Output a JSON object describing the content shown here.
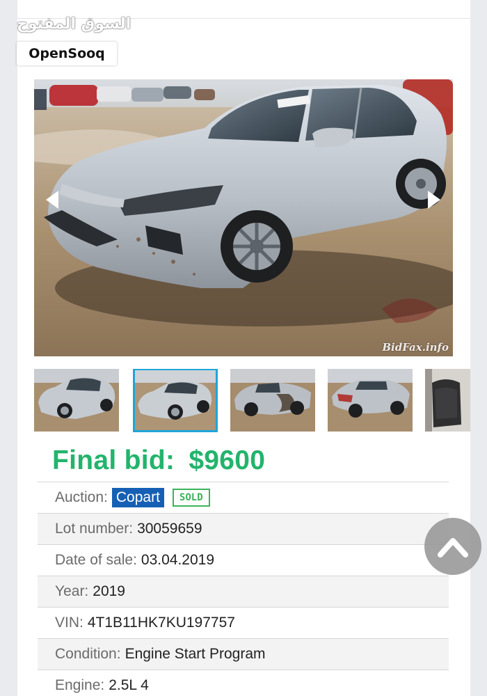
{
  "watermark": {
    "arabic": "السوق المفتوح",
    "brand": "OpenSooq"
  },
  "photo": {
    "watermark": "BidFax.info",
    "thumbnail_count": 5,
    "active_thumbnail": 2
  },
  "listing": {
    "final_bid_label": "Final bid:",
    "final_bid_value": "$9600",
    "rows": [
      {
        "label": "Auction:",
        "value": "Copart",
        "badge": "SOLD"
      },
      {
        "label": "Lot number:",
        "value": "30059659"
      },
      {
        "label": "Date of sale:",
        "value": "03.04.2019"
      },
      {
        "label": "Year:",
        "value": "2019"
      },
      {
        "label": "VIN:",
        "value": "4T1B11HK7KU197757"
      },
      {
        "label": "Condition:",
        "value": "Engine Start Program"
      },
      {
        "label": "Engine:",
        "value": "2.5L 4"
      }
    ]
  },
  "colors": {
    "final_bid": "#23b46c",
    "copart_badge": "#1560b4",
    "sold_badge": "#3ab35a",
    "active_thumb_border": "#1fa5d9"
  },
  "icons": [
    "expand-icon",
    "chevron-left-icon",
    "chevron-right-icon",
    "chevron-up-icon"
  ]
}
